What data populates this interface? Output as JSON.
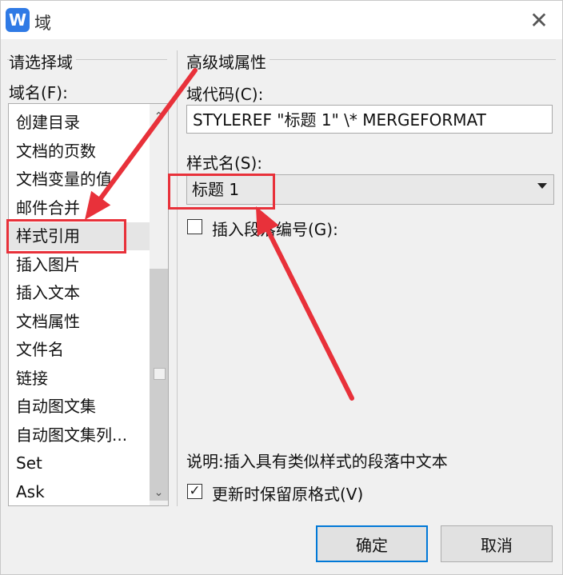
{
  "window": {
    "app_icon_letter": "W",
    "title": "域",
    "close_symbol": "✕"
  },
  "left_group": {
    "title": "请选择域",
    "field_label": "域名(F):",
    "items": [
      "创建目录",
      "文档的页数",
      "文档变量的值",
      "邮件合并",
      "样式引用",
      "插入图片",
      "插入文本",
      "文档属性",
      "文件名",
      "链接",
      "自动图文集",
      "自动图文集列...",
      "Set",
      "Ask"
    ],
    "selected_index": 4
  },
  "right_group": {
    "title": "高级域属性",
    "code_label": "域代码(C):",
    "code_value": "STYLEREF \"标题 1\" \\* MERGEFORMAT",
    "style_label": "样式名(S):",
    "style_value": "标题 1",
    "insert_paragraph_label": "插入段落编号(G):",
    "insert_paragraph_checked": false,
    "description": "说明:插入具有类似样式的段落中文本",
    "preserve_format_label": "更新时保留原格式(V)",
    "preserve_format_checked": true
  },
  "buttons": {
    "ok": "确定",
    "cancel": "取消"
  },
  "annotation_color": "#e8313a",
  "scroll_up_symbol": "⌃",
  "scroll_down_symbol": "⌄"
}
